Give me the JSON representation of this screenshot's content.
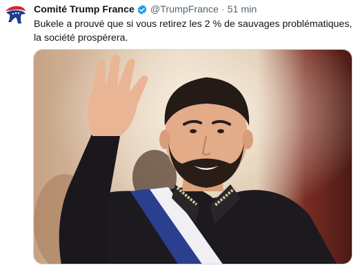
{
  "tweet": {
    "author_name": "Comité Trump France",
    "handle": "@TrumpFrance",
    "separator": "·",
    "time": "51 min",
    "text": "Bukele a prouvé que si vous retirez les 2 % de sauvages problématiques, la société prospérera.",
    "verified_badge_color": "#1d9bf0",
    "avatar_icon": "elephant-logo-icon",
    "avatar_colors": [
      "#1d3c8f",
      "#d6232a"
    ]
  },
  "media": {
    "type": "photo"
  }
}
